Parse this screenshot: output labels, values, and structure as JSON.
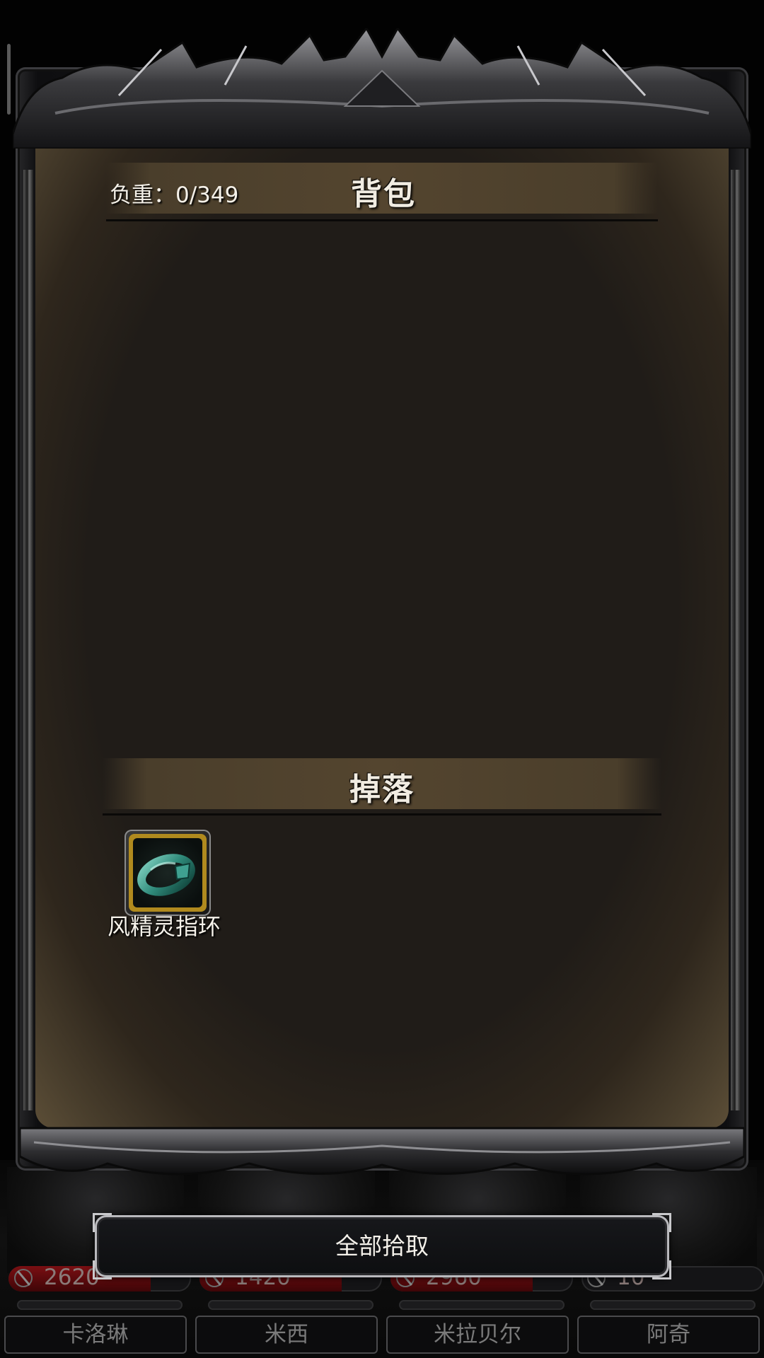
{
  "inventory_panel": {
    "bag_title": "背包",
    "weight_text": "负重：0/349",
    "drops_title": "掉落",
    "drops": [
      {
        "name": "风精灵指环",
        "icon": "ring-icon",
        "rarity_color": "#b08a1e"
      }
    ]
  },
  "actions": {
    "collect_all_label": "全部拾取"
  },
  "party": [
    {
      "name": "卡洛琳",
      "hp": "2620",
      "hp_fraction": 0.78
    },
    {
      "name": "米西",
      "hp": "1420",
      "hp_fraction": 0.78
    },
    {
      "name": "米拉贝尔",
      "hp": "2960",
      "hp_fraction": 0.78
    },
    {
      "name": "阿奇",
      "hp": "10",
      "hp_fraction": 0.0
    }
  ],
  "colors": {
    "hp_red": "#7a0f12",
    "parchment": "#201c18",
    "band": "#54452f"
  }
}
